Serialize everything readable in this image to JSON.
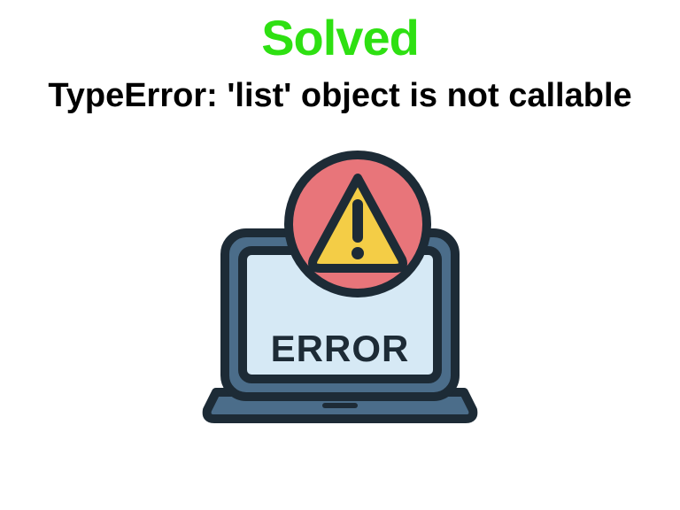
{
  "heading": {
    "solved": "Solved",
    "error_message": "TypeError: 'list' object is not callable"
  },
  "illustration": {
    "label": "ERROR",
    "colors": {
      "laptop_body": "#4b6d8a",
      "screen_bg": "#d6e9f5",
      "warning_circle": "#e8757a",
      "warning_triangle_fill": "#f4cd46",
      "outline": "#1d2b36"
    }
  }
}
